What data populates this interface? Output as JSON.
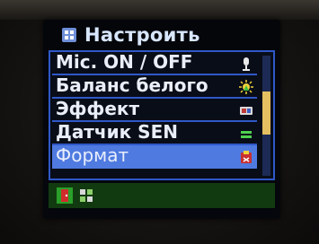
{
  "screen": {
    "title": "Настроить",
    "menu_items": [
      {
        "label": "Mic. ON / OFF",
        "icon": "microphone-icon"
      },
      {
        "label": "Баланс белого",
        "icon": "white-balance-icon"
      },
      {
        "label": "Эффект",
        "icon": "effect-icon"
      },
      {
        "label": "Датчик SEN",
        "icon": "sensor-icon"
      },
      {
        "label": "Формат",
        "icon": "format-icon",
        "selected": true
      }
    ],
    "bottom_icons": [
      "exit-icon",
      "settings-icon"
    ]
  },
  "colors": {
    "screen_bg": "#05070c",
    "menu_border": "#2f58c8",
    "selected_row": "#4f7ae0",
    "bottom_bar": "#123a10",
    "scroll_thumb": "#e4c060"
  }
}
